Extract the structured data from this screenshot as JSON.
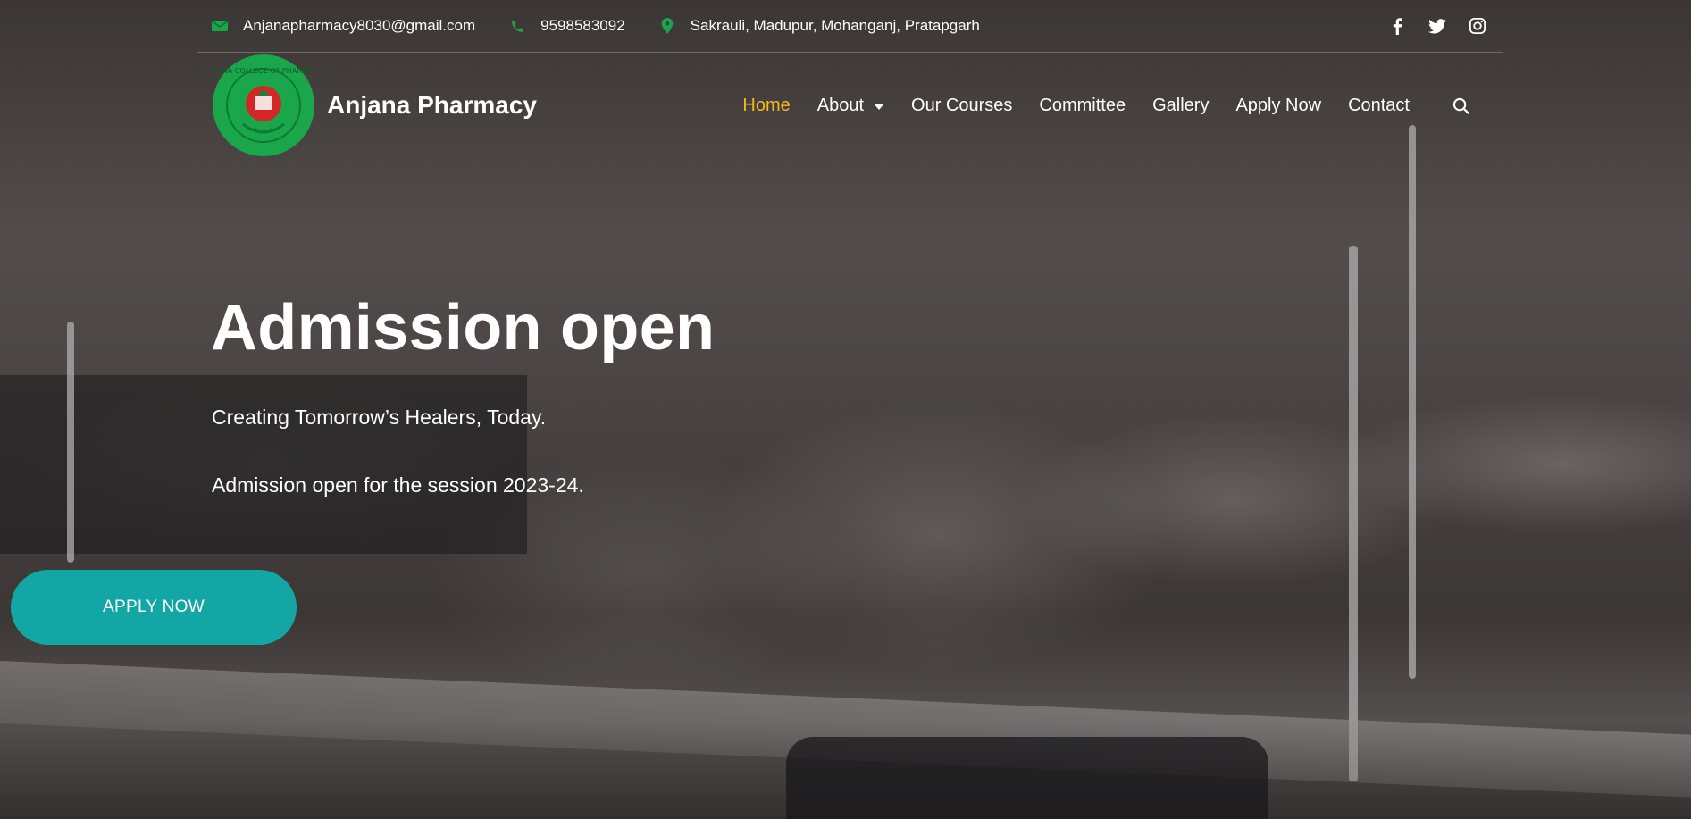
{
  "topbar": {
    "email": "Anjanapharmacy8030@gmail.com",
    "phone": "9598583092",
    "address": "Sakrauli, Madupur, Mohanganj, Pratapgarh",
    "icon_color": "#1aa64a",
    "social": [
      "facebook-icon",
      "twitter-icon",
      "instagram-icon"
    ]
  },
  "header": {
    "brand": "Anjana Pharmacy",
    "logo_color": "#1aa64a"
  },
  "nav": {
    "items": [
      {
        "label": "Home",
        "active": true
      },
      {
        "label": "About",
        "dropdown": true
      },
      {
        "label": "Our Courses"
      },
      {
        "label": "Committee"
      },
      {
        "label": "Gallery"
      },
      {
        "label": "Apply Now"
      },
      {
        "label": "Contact"
      }
    ],
    "active_color": "#f6b91c",
    "search_icon": "search-icon"
  },
  "hero": {
    "title": "Admission open",
    "tagline": "Creating Tomorrow’s Healers, Today.",
    "session": "Admission open for the session 2023-24.",
    "cta": "APPLY NOW",
    "cta_color": "#12a7a5"
  }
}
